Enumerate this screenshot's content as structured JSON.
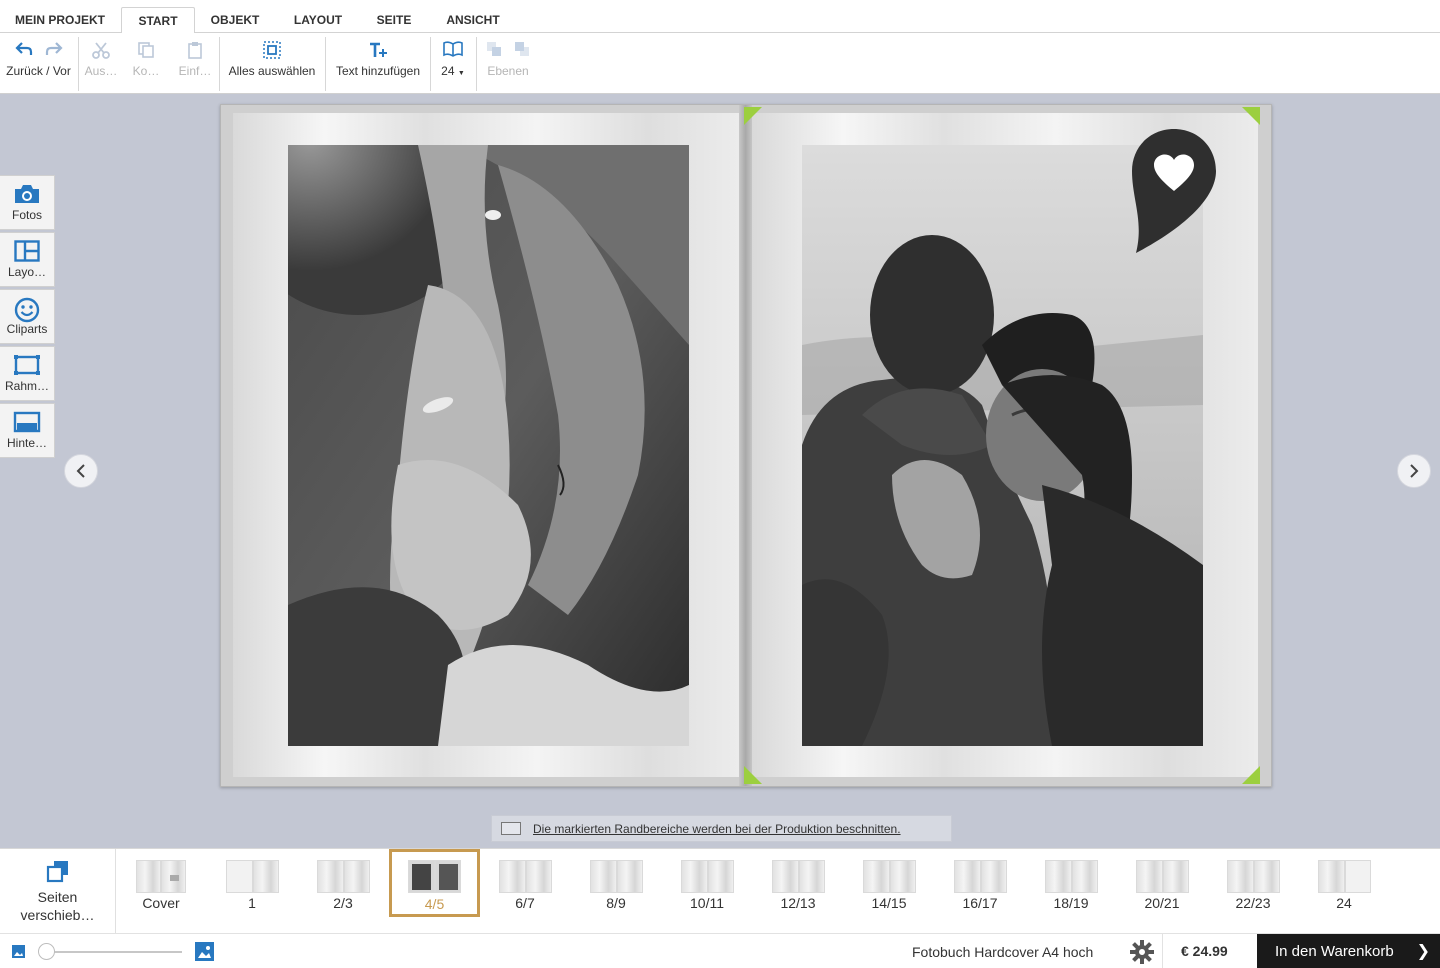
{
  "menu": {
    "tabs": [
      {
        "label": "MEIN PROJEKT"
      },
      {
        "label": "START"
      },
      {
        "label": "OBJEKT"
      },
      {
        "label": "LAYOUT"
      },
      {
        "label": "SEITE"
      },
      {
        "label": "ANSICHT"
      }
    ],
    "active_tab": "START"
  },
  "toolbar": {
    "undo_redo_label": "Zurück / Vor",
    "cut_label": "Aus…",
    "copy_label": "Ko…",
    "paste_label": "Einf…",
    "select_all_label": "Alles auswählen",
    "add_text_label": "Text hinzufügen",
    "page_count_label": "24",
    "layers_label": "Ebenen"
  },
  "sidebar": {
    "items": [
      {
        "label": "Fotos",
        "icon": "camera-icon"
      },
      {
        "label": "Layo…",
        "icon": "layout-icon"
      },
      {
        "label": "Cliparts",
        "icon": "smiley-icon"
      },
      {
        "label": "Rahm…",
        "icon": "frame-icon"
      },
      {
        "label": "Hinte…",
        "icon": "background-icon"
      }
    ]
  },
  "notice": {
    "text": "Die markierten Randbereiche werden bei der Produktion beschnitten."
  },
  "page_strip": {
    "reorder_label": "Seiten verschieb…",
    "thumbs": [
      {
        "label": "Cover"
      },
      {
        "label": "1"
      },
      {
        "label": "2/3"
      },
      {
        "label": "4/5"
      },
      {
        "label": "6/7"
      },
      {
        "label": "8/9"
      },
      {
        "label": "10/11"
      },
      {
        "label": "12/13"
      },
      {
        "label": "14/15"
      },
      {
        "label": "16/17"
      },
      {
        "label": "18/19"
      },
      {
        "label": "20/21"
      },
      {
        "label": "22/23"
      },
      {
        "label": "24"
      }
    ],
    "active": "4/5"
  },
  "status": {
    "product": "Fotobuch Hardcover A4 hoch",
    "price": "€ 24.99",
    "cart_label": "In den Warenkorb"
  },
  "colors": {
    "accent_blue": "#2878c0",
    "active_thumb": "#c79a50",
    "canvas_bg": "#c3c7d3",
    "cart_bg": "#1a1a1a",
    "crop_marker": "#9ccf3f"
  }
}
